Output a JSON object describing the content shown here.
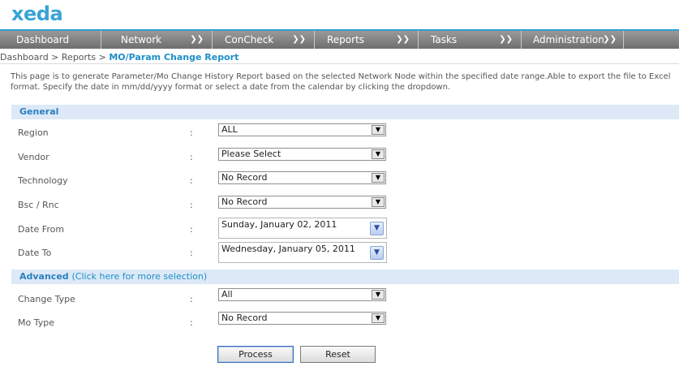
{
  "header": {
    "logo": "xeda"
  },
  "nav": [
    {
      "label": "Dashboard",
      "chevron": ""
    },
    {
      "label": "Network",
      "chevron": "❯❯"
    },
    {
      "label": "ConCheck",
      "chevron": "❯❯"
    },
    {
      "label": "Reports",
      "chevron": "❯❯"
    },
    {
      "label": "Tasks",
      "chevron": "❯❯"
    },
    {
      "label": "Administration",
      "chevron": "❯❯"
    }
  ],
  "breadcrumb": {
    "root": "Dashboard",
    "sep1": " > ",
    "parent": "Reports",
    "sep2": " > ",
    "current": "MO/Param Change Report"
  },
  "description": "This page is to generate Parameter/Mo Change History Report based on the selected Network Node within the specified date range.Able to export the file to Excel format. Specify the date in mm/dd/yyyy format or select a date from the calendar by clicking the dropdown.",
  "general": {
    "title": "General",
    "region": {
      "label": "Region",
      "colon": ":",
      "value": "ALL"
    },
    "vendor": {
      "label": "Vendor",
      "colon": ":",
      "value": "Please Select"
    },
    "technology": {
      "label": "Technology",
      "colon": ":",
      "value": "No Record"
    },
    "bsc": {
      "label": "Bsc / Rnc",
      "colon": ":",
      "value": "No Record"
    },
    "date_from": {
      "label": "Date From",
      "colon": ":",
      "value": "Sunday, January 02, 2011"
    },
    "date_to": {
      "label": "Date To",
      "colon": ":",
      "value": "Wednesday, January 05, 2011"
    }
  },
  "advanced": {
    "title": "Advanced",
    "link": "(Click here for more selection)",
    "change_type": {
      "label": "Change Type",
      "colon": ":",
      "value": "All"
    },
    "mo_type": {
      "label": "Mo Type",
      "colon": ":",
      "value": "No Record"
    }
  },
  "buttons": {
    "process": "Process",
    "reset": "Reset"
  },
  "icons": {
    "dropdown": "▼",
    "calendar": "▼",
    "nav_chevron": "chevron-double-down-icon"
  },
  "colors": {
    "accent": "#2f9bd0",
    "section_bg": "#dde9f7",
    "nav_bg": "#8a8a8a"
  }
}
